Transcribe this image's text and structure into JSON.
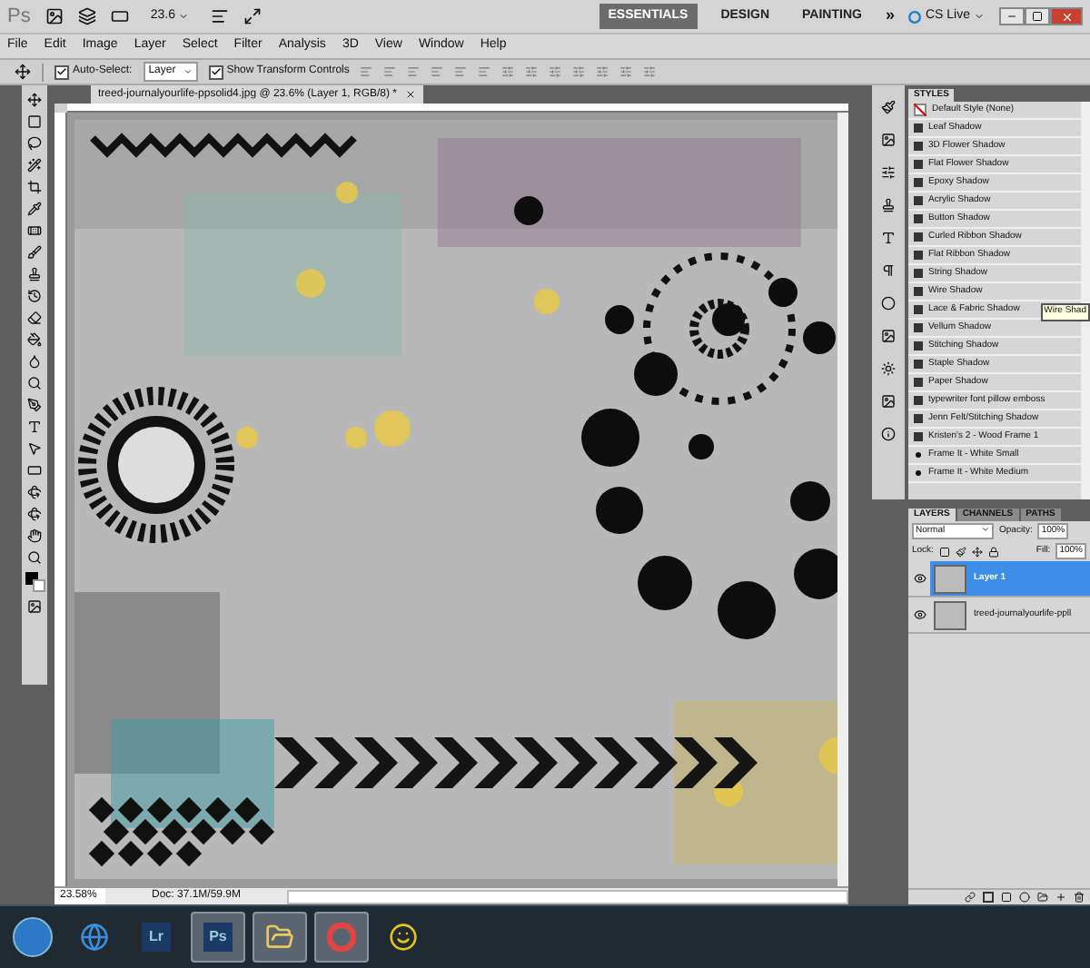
{
  "app_bar": {
    "logo": "Ps",
    "zoom": "23.6",
    "workspaces": [
      {
        "label": "ESSENTIALS",
        "selected": true
      },
      {
        "label": "DESIGN",
        "selected": false
      },
      {
        "label": "PAINTING",
        "selected": false
      }
    ],
    "more": "»",
    "cs_live": "CS Live"
  },
  "menu": [
    "File",
    "Edit",
    "Image",
    "Layer",
    "Select",
    "Filter",
    "Analysis",
    "3D",
    "View",
    "Window",
    "Help"
  ],
  "options": {
    "auto_select": {
      "label": "Auto-Select:",
      "checked": true
    },
    "target": "Layer",
    "show_transform": {
      "label": "Show Transform Controls",
      "checked": true
    }
  },
  "document": {
    "tab_title": "treed-journalyourlife-ppsolid4.jpg @ 23.6% (Layer 1, RGB/8) *",
    "zoom": "23.58%",
    "doc_size": "Doc: 37.1M/59.9M"
  },
  "styles": {
    "title": "STYLES",
    "tooltip": "Wire Shad",
    "items": [
      {
        "name": "Default Style (None)",
        "kind": "none"
      },
      {
        "name": "Leaf Shadow",
        "kind": "swatch"
      },
      {
        "name": "3D Flower Shadow",
        "kind": "swatch"
      },
      {
        "name": "Flat Flower Shadow",
        "kind": "swatch"
      },
      {
        "name": "Epoxy Shadow",
        "kind": "swatch"
      },
      {
        "name": "Acrylic Shadow",
        "kind": "swatch"
      },
      {
        "name": "Button Shadow",
        "kind": "swatch"
      },
      {
        "name": "Curled Ribbon Shadow",
        "kind": "swatch"
      },
      {
        "name": "Flat Ribbon Shadow",
        "kind": "swatch"
      },
      {
        "name": "String Shadow",
        "kind": "swatch"
      },
      {
        "name": "Wire Shadow",
        "kind": "swatch"
      },
      {
        "name": "Lace & Fabric Shadow",
        "kind": "swatch"
      },
      {
        "name": "Vellum Shadow",
        "kind": "swatch"
      },
      {
        "name": "Stitching Shadow",
        "kind": "swatch"
      },
      {
        "name": "Staple Shadow",
        "kind": "swatch"
      },
      {
        "name": "Paper Shadow",
        "kind": "swatch"
      },
      {
        "name": "typewriter font pillow emboss",
        "kind": "swatch"
      },
      {
        "name": "Jenn Felt/Stitching Shadow",
        "kind": "swatch"
      },
      {
        "name": "Kristen's 2 - Wood Frame 1",
        "kind": "swatch"
      },
      {
        "name": "Frame It - White Small",
        "kind": "dot"
      },
      {
        "name": "Frame It - White Medium",
        "kind": "dot"
      }
    ]
  },
  "layers_panel": {
    "tabs": [
      {
        "label": "LAYERS",
        "selected": true
      },
      {
        "label": "CHANNELS",
        "selected": false
      },
      {
        "label": "PATHS",
        "selected": false
      }
    ],
    "blend_mode": "Normal",
    "opacity_label": "Opacity:",
    "opacity": "100%",
    "lock_label": "Lock:",
    "fill_label": "Fill:",
    "fill": "100%",
    "layers": [
      {
        "name": "Layer 1",
        "selected": true,
        "visible": true
      },
      {
        "name": "treed-journalyourlife-ppll",
        "selected": false,
        "visible": true
      }
    ]
  },
  "taskbar": [
    {
      "kind": "start",
      "running": false
    },
    {
      "kind": "browser",
      "running": false
    },
    {
      "kind": "app",
      "label": "Lr",
      "running": false
    },
    {
      "kind": "app",
      "label": "Ps",
      "running": true
    },
    {
      "kind": "folder",
      "running": true
    },
    {
      "kind": "chrome",
      "running": true
    },
    {
      "kind": "messenger",
      "running": false
    }
  ]
}
